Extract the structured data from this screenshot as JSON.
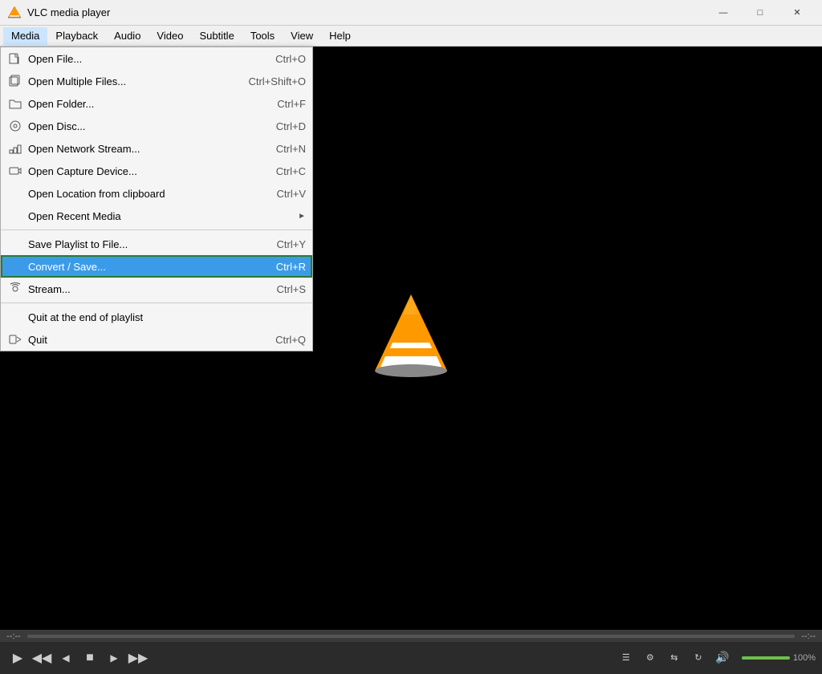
{
  "titlebar": {
    "app_name": "VLC media player",
    "icon": "🎬"
  },
  "menubar": {
    "items": [
      {
        "id": "media",
        "label": "Media",
        "active": true
      },
      {
        "id": "playback",
        "label": "Playback"
      },
      {
        "id": "audio",
        "label": "Audio"
      },
      {
        "id": "video",
        "label": "Video"
      },
      {
        "id": "subtitle",
        "label": "Subtitle"
      },
      {
        "id": "tools",
        "label": "Tools"
      },
      {
        "id": "view",
        "label": "View"
      },
      {
        "id": "help",
        "label": "Help"
      }
    ]
  },
  "media_menu": {
    "items": [
      {
        "id": "open-file",
        "label": "Open File...",
        "shortcut": "Ctrl+O",
        "icon": "📄",
        "separator_after": false
      },
      {
        "id": "open-multiple",
        "label": "Open Multiple Files...",
        "shortcut": "Ctrl+Shift+O",
        "icon": "📂",
        "separator_after": false
      },
      {
        "id": "open-folder",
        "label": "Open Folder...",
        "shortcut": "Ctrl+F",
        "icon": "📁",
        "separator_after": false
      },
      {
        "id": "open-disc",
        "label": "Open Disc...",
        "shortcut": "Ctrl+D",
        "icon": "💿",
        "separator_after": false
      },
      {
        "id": "open-network",
        "label": "Open Network Stream...",
        "shortcut": "Ctrl+N",
        "icon": "🌐",
        "separator_after": false
      },
      {
        "id": "open-capture",
        "label": "Open Capture Device...",
        "shortcut": "Ctrl+C",
        "icon": "📷",
        "separator_after": false
      },
      {
        "id": "open-location",
        "label": "Open Location from clipboard",
        "shortcut": "Ctrl+V",
        "icon": "",
        "separator_after": false
      },
      {
        "id": "open-recent",
        "label": "Open Recent Media",
        "shortcut": "",
        "icon": "",
        "arrow": true,
        "separator_after": true
      },
      {
        "id": "save-playlist",
        "label": "Save Playlist to File...",
        "shortcut": "Ctrl+Y",
        "icon": "",
        "separator_after": false
      },
      {
        "id": "convert-save",
        "label": "Convert / Save...",
        "shortcut": "Ctrl+R",
        "icon": "",
        "highlighted": true,
        "separator_after": false
      },
      {
        "id": "stream",
        "label": "Stream...",
        "shortcut": "Ctrl+S",
        "icon": "",
        "separator_after": true
      },
      {
        "id": "quit-end",
        "label": "Quit at the end of playlist",
        "shortcut": "",
        "icon": "",
        "separator_after": false
      },
      {
        "id": "quit",
        "label": "Quit",
        "shortcut": "Ctrl+Q",
        "icon": "",
        "separator_after": false
      }
    ]
  },
  "controls": {
    "time_left": "--:--",
    "time_right": "--:--",
    "volume": "100%",
    "buttons": [
      {
        "id": "play",
        "icon": "▶",
        "label": "Play"
      },
      {
        "id": "prev",
        "icon": "⏮",
        "label": "Previous"
      },
      {
        "id": "back",
        "icon": "⏪",
        "label": "Back"
      },
      {
        "id": "stop",
        "icon": "⏹",
        "label": "Stop"
      },
      {
        "id": "forward",
        "icon": "⏩",
        "label": "Forward"
      },
      {
        "id": "next",
        "icon": "⏭",
        "label": "Next"
      }
    ]
  }
}
